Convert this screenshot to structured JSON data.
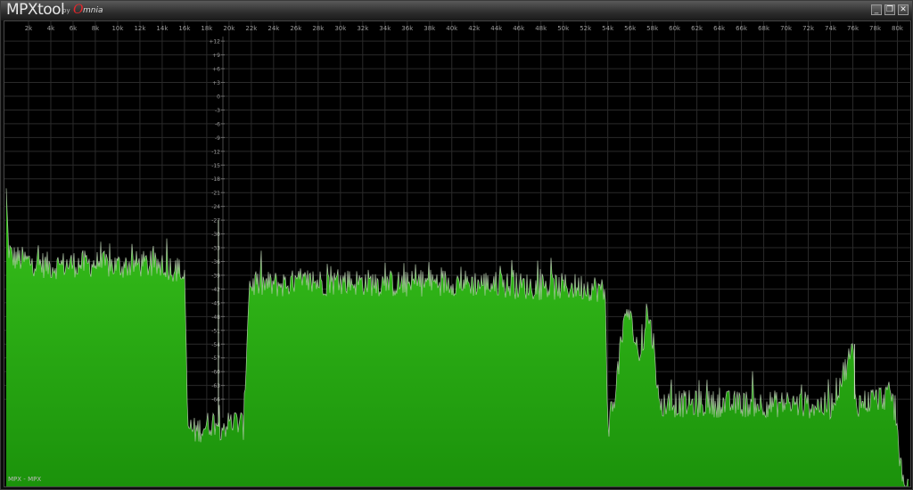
{
  "window": {
    "title": "MPXtool",
    "by_text": "by",
    "brand_initial": "O",
    "brand_rest": "mnia",
    "buttons": [
      {
        "name": "minimize-button",
        "glyph": "_"
      },
      {
        "name": "restore-button",
        "glyph": "❐"
      },
      {
        "name": "close-button",
        "glyph": "✕"
      }
    ]
  },
  "status": {
    "left_label": "MPX",
    "separator": "-",
    "right_label": "MPX"
  },
  "colors": {
    "fill_top": "#38c21c",
    "fill_bottom": "#1b920b",
    "noise_edge": "#c8d8c0",
    "grid": "#2a2a2a",
    "tick_text": "#9a9a9a"
  },
  "chart_data": {
    "type": "area",
    "x_unit": "kHz",
    "y_unit": "dB",
    "xlim": [
      0,
      81
    ],
    "ylim": [
      -85,
      13
    ],
    "grid": true,
    "x_ticks": [
      "2k",
      "4k",
      "6k",
      "8k",
      "10k",
      "12k",
      "14k",
      "16k",
      "18k",
      "20k",
      "22k",
      "24k",
      "26k",
      "28k",
      "30k",
      "32k",
      "34k",
      "36k",
      "38k",
      "40k",
      "42k",
      "44k",
      "46k",
      "48k",
      "50k",
      "52k",
      "54k",
      "56k",
      "58k",
      "60k",
      "62k",
      "64k",
      "66k",
      "68k",
      "70k",
      "72k",
      "74k",
      "76k",
      "78k",
      "80k"
    ],
    "y_ticks": [
      "+12",
      "+9",
      "+6",
      "+3",
      "0",
      "-3",
      "-6",
      "-9",
      "-12",
      "-15",
      "-18",
      "-21",
      "-24",
      "-27",
      "-30",
      "-33",
      "-36",
      "-39",
      "-42",
      "-45",
      "-48",
      "-51",
      "-54",
      "-57",
      "-60",
      "-63",
      "-66"
    ],
    "series": [
      {
        "x": [
          0,
          0.2,
          0.5,
          2,
          4,
          6,
          8,
          10,
          12,
          13.5,
          14.5,
          15.5,
          15.8,
          16.0,
          16.3,
          17,
          18.5,
          19.0,
          19.2,
          20.5,
          21.0,
          21.3,
          21.8,
          24,
          28,
          32,
          36,
          38,
          40,
          44,
          48,
          52,
          53.4,
          53.8,
          54.0,
          54.3,
          55.0,
          55.7,
          56.5,
          57.0,
          57.5,
          58.2,
          58.6,
          59,
          62,
          66,
          70,
          74,
          76.0,
          76.3,
          78,
          79.5,
          80.0,
          80.3,
          80.6
        ],
        "y": [
          -21,
          -33,
          -35,
          -36,
          -37,
          -36.5,
          -36.5,
          -37,
          -36.5,
          -37,
          -37,
          -38,
          -39,
          -40,
          -72,
          -73,
          -71,
          -71,
          -72,
          -71,
          -71,
          -72,
          -41,
          -41,
          -40.5,
          -40.5,
          -41,
          -40.5,
          -40.5,
          -41,
          -41.5,
          -41.5,
          -42,
          -44,
          -72,
          -70,
          -58,
          -46,
          -53,
          -58,
          -46,
          -55,
          -68,
          -67,
          -67,
          -67,
          -67,
          -67.5,
          -55,
          -67,
          -66,
          -65,
          -72,
          -82,
          -85
        ]
      }
    ]
  }
}
